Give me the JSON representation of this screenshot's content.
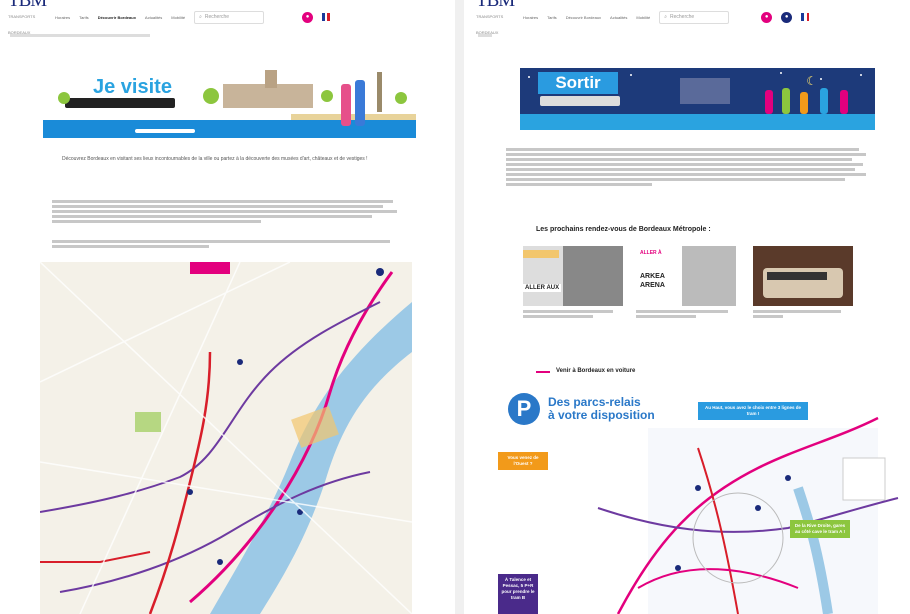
{
  "left": {
    "logo": "TBM",
    "nav": [
      "Horaires",
      "Tarifs",
      "Découvrir Bordeaux",
      "Actualités",
      "Mobilité"
    ],
    "search_placeholder": "Recherche",
    "banner_title": "Je visite",
    "intro": "Découvrez Bordeaux en visitant ses lieux incontournables de la ville ou partez à la découverte des musées d'art, châteaux et de vestiges !"
  },
  "right": {
    "logo": "TBM",
    "nav": [
      "Horaires",
      "Tarifs",
      "Découvrir Bordeaux",
      "Actualités",
      "Mobilité"
    ],
    "search_placeholder": "Recherche",
    "banner_title": "Sortir",
    "events_heading": "Les prochains rendez-vous de Bordeaux Métropole :",
    "cards": [
      {
        "line1": "ALLER AUX",
        "line2": ""
      },
      {
        "line1": "ALLER À",
        "line2": "ARKEA ARENA"
      },
      {
        "line1": "",
        "line2": ""
      }
    ],
    "car_heading": "Venir à Bordeaux en voiture",
    "parcs_title_1": "Des parcs-relais",
    "parcs_title_2": "à votre disposition",
    "parcs_p": "P",
    "box_blue": "Au Haut, vous avez le choix entre 3 lignes de tram !",
    "box_orange": "Vous venez de l'Ouest ?",
    "box_green": "De la Rive Droite, gares au côté cave le tram A !",
    "box_purple": "À Talence et Pessac, 5 P+R pour prendre le tram B"
  },
  "colors": {
    "tbm_blue": "#1a2a7a",
    "tbm_pink": "#e3007e",
    "sky": "#2aa3e0",
    "night": "#1d3a7a"
  }
}
